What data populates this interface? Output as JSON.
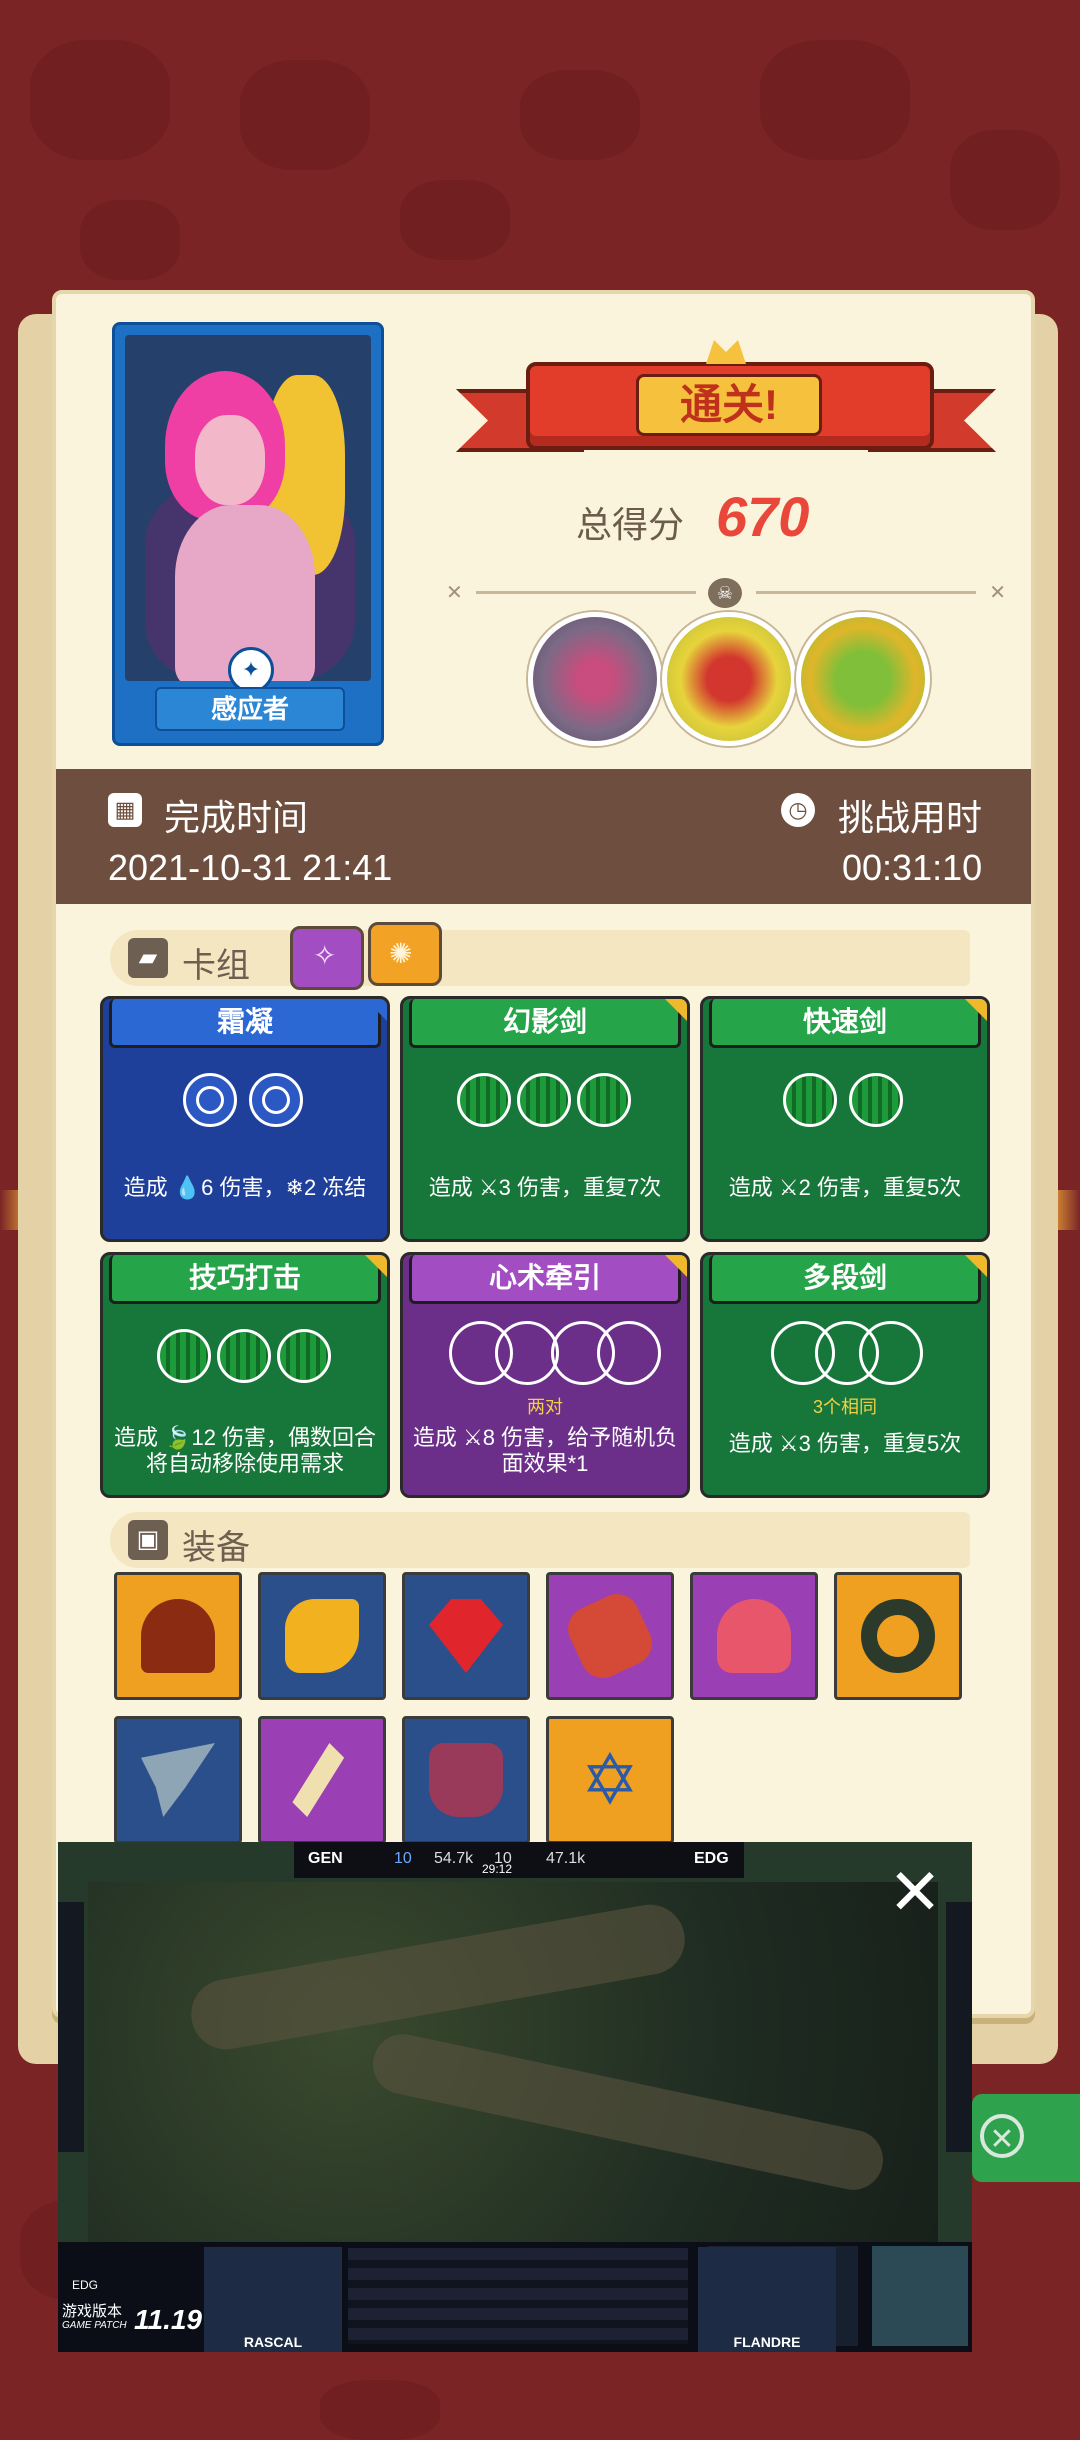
{
  "result": {
    "banner": "通关!",
    "score_label": "总得分",
    "score_value": "670"
  },
  "character": {
    "name": "感应者"
  },
  "info": {
    "finish_label": "完成时间",
    "finish_value": "2021-10-31 21:41",
    "duration_label": "挑战用时",
    "duration_value": "00:31:10"
  },
  "deck": {
    "title": "卡组",
    "cards": [
      {
        "name": "霜凝",
        "desc": "造成 💧6 伤害，❄2 冻结",
        "color": "blue"
      },
      {
        "name": "幻影剑",
        "desc": "造成 ⚔3 伤害，重复7次",
        "color": "green"
      },
      {
        "name": "快速剑",
        "desc": "造成 ⚔2 伤害，重复5次",
        "color": "green"
      },
      {
        "name": "技巧打击",
        "desc": "造成 🍃12 伤害，偶数回合将自动移除使用需求",
        "color": "green"
      },
      {
        "name": "心术牵引",
        "sub": "两对",
        "desc": "造成 ⚔8 伤害，给予随机负面效果*1",
        "color": "purple"
      },
      {
        "name": "多段剑",
        "sub": "3个相同",
        "desc": "造成 ⚔3 伤害，重复5次",
        "color": "green"
      }
    ]
  },
  "equipment": {
    "title": "装备",
    "items": [
      {
        "icon": "hood-icon",
        "color": "#f0a020"
      },
      {
        "icon": "gold-horn-icon",
        "color": "#2b4f8a"
      },
      {
        "icon": "ruby-gem-icon",
        "color": "#2b4f8a"
      },
      {
        "icon": "red-bracer-icon",
        "color": "#9b3fb5"
      },
      {
        "icon": "pink-mushroom-icon",
        "color": "#9b3fb5"
      },
      {
        "icon": "dark-ring-icon",
        "color": "#f0a020"
      },
      {
        "icon": "scythe-icon",
        "color": "#2b4f8a"
      },
      {
        "icon": "dagger-icon",
        "color": "#9b3fb5"
      },
      {
        "icon": "armor-icon",
        "color": "#2b4f8a"
      },
      {
        "icon": "hexagram-icon",
        "color": "#f0a020"
      }
    ]
  },
  "video": {
    "team_left": "GEN",
    "team_right": "EDG",
    "left_kills": "10",
    "left_gold": "54.7k",
    "right_kills": "10",
    "right_gold": "47.1k",
    "game_time": "29:12",
    "patch_label": "游戏版本",
    "patch_sub": "GAME PATCH",
    "patch_value": "11.19",
    "player_left": "RASCAL",
    "player_right": "FLANDRE",
    "team_tag": "EDG"
  },
  "colors": {
    "background": "#7a2426",
    "panel": "#fbf4dd",
    "score": "#e8473a",
    "info_bar": "#6e4f3f",
    "blue_card": "#1e3f9a",
    "green_card": "#17763a",
    "purple_card": "#6b2f8a"
  }
}
